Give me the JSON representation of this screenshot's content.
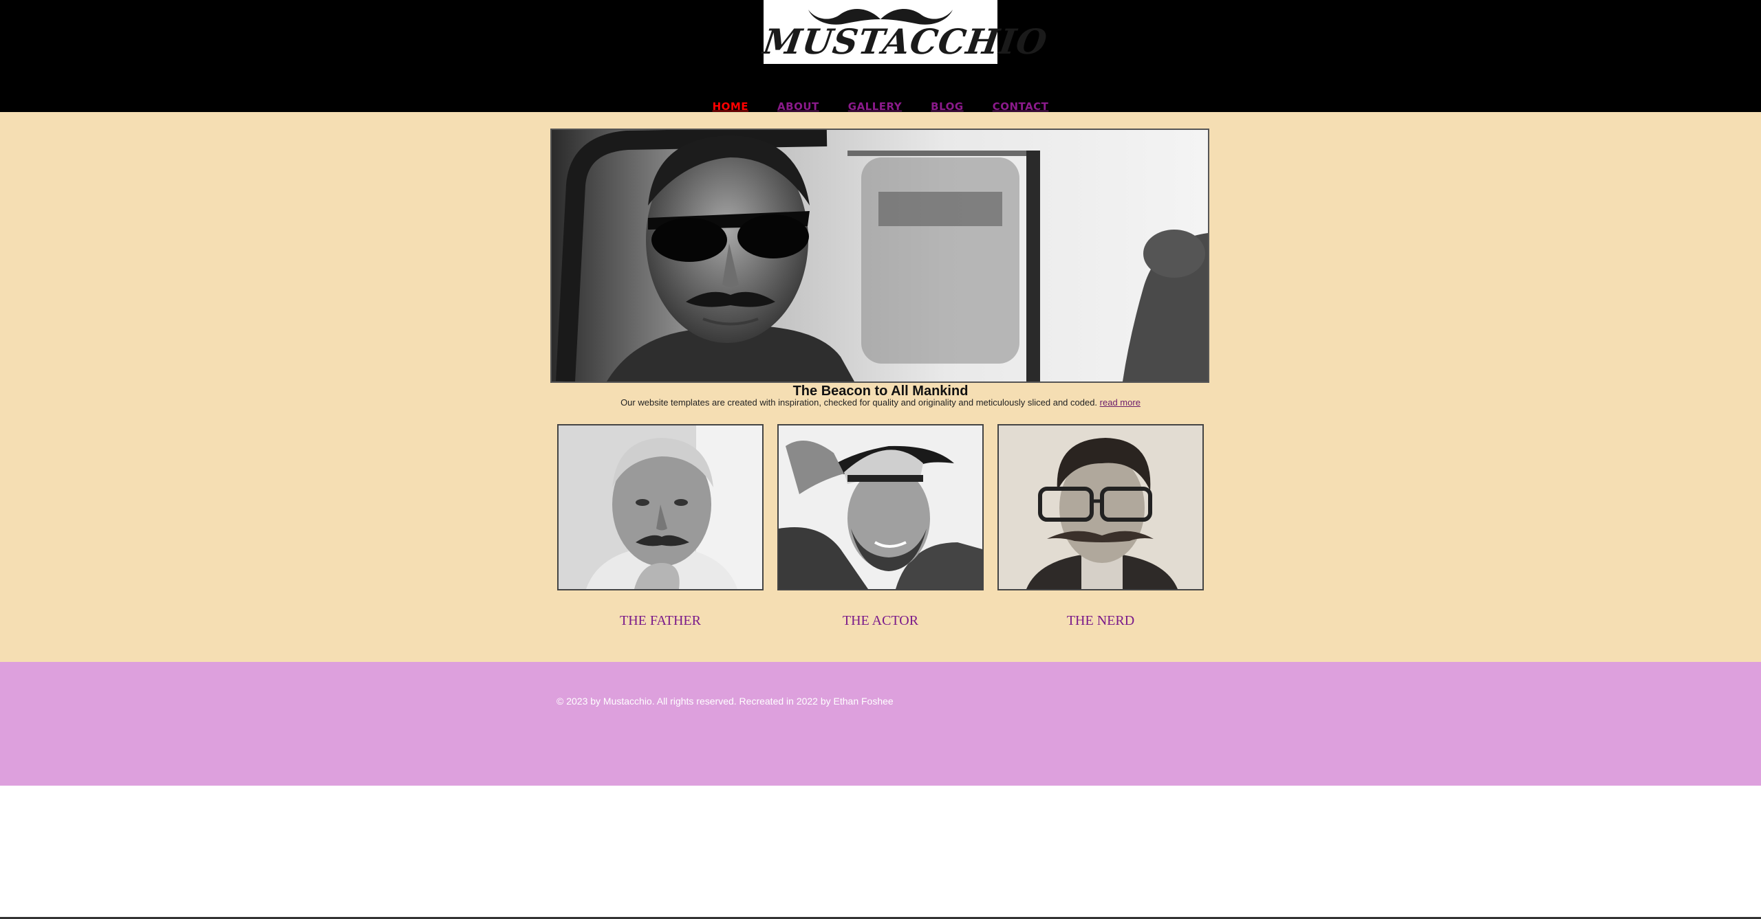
{
  "brand": {
    "logo_text": "MUSTACCHIO"
  },
  "nav": {
    "items": [
      {
        "label": "HOME",
        "active": true
      },
      {
        "label": "ABOUT",
        "active": false
      },
      {
        "label": "GALLERY",
        "active": false
      },
      {
        "label": "BLOG",
        "active": false
      },
      {
        "label": "CONTACT",
        "active": false
      }
    ]
  },
  "hero": {
    "headline": "The Beacon to All Mankind",
    "tagline": "Our website templates are created with inspiration, checked for quality and originality and meticulously sliced and coded.",
    "read_more": "read more"
  },
  "cards": [
    {
      "caption": "THE FATHER"
    },
    {
      "caption": "THE ACTOR"
    },
    {
      "caption": "THE NERD"
    }
  ],
  "footer": {
    "text": "© 2023 by Mustacchio. All rights reserved. Recreated in 2022 by Ethan Foshee"
  },
  "colors": {
    "header_bg": "#000000",
    "main_bg": "#f5deb3",
    "footer_bg": "#dda0dd",
    "nav_active": "#ff0000",
    "nav_link": "#8b1a8b",
    "caption": "#7a1a8a"
  }
}
